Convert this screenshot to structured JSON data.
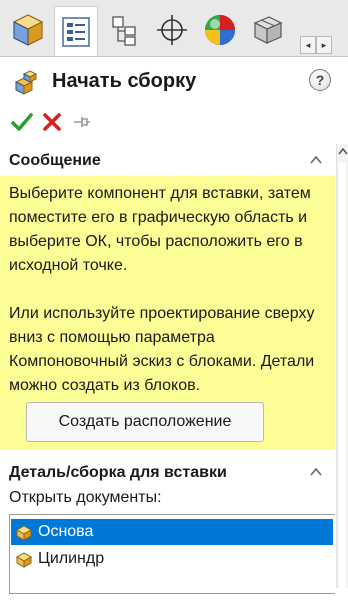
{
  "manager_tabs": [
    {
      "icon": "feature-manager-icon",
      "active": false
    },
    {
      "icon": "property-manager-icon",
      "active": true
    },
    {
      "icon": "configuration-manager-icon",
      "active": false
    },
    {
      "icon": "dimxpert-manager-icon",
      "active": false
    },
    {
      "icon": "display-manager-icon",
      "active": false
    },
    {
      "icon": "cam-manager-icon",
      "active": false
    }
  ],
  "property_manager": {
    "title": "Начать сборку",
    "help_label": "?",
    "actions": {
      "ok_icon": "check-icon",
      "cancel_icon": "x-icon",
      "pin_icon": "pushpin-icon"
    }
  },
  "message_group": {
    "title": "Сообщение",
    "paragraph_1": "Выберите компонент для вставки, затем поместите его в графическую область и выберите ОК, чтобы расположить его в исходной точке.",
    "paragraph_2": "Или используйте проектирование сверху вниз с помощью параметра Компоновочный эскиз с блоками. Детали можно создать из блоков.",
    "button_label": "Создать расположение",
    "background": "#fdfd96"
  },
  "insert_group": {
    "title": "Деталь/сборка для вставки",
    "open_docs_label": "Открыть документы:",
    "documents": [
      {
        "name": "Основа",
        "selected": true
      },
      {
        "name": "Цилиндр",
        "selected": false
      }
    ]
  },
  "colors": {
    "selection": "#0078d7",
    "ok_green": "#2e9e2e",
    "cancel_red": "#d92020"
  }
}
